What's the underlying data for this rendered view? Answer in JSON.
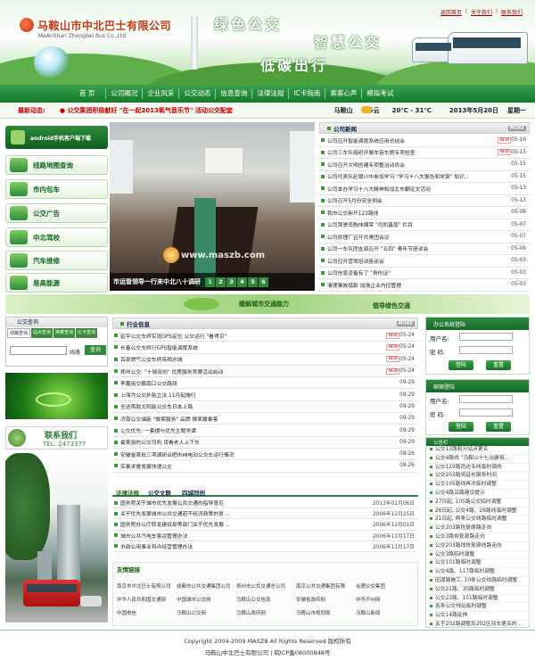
{
  "header": {
    "company_cn": "马鞍山市中北巴士有限公司",
    "company_en": "MaAnShan Zhongbei Bus Co.,Ltd",
    "slogan1": "绿色公交",
    "slogan2": "智慧公交",
    "slogan3": "低碳出行",
    "links": [
      "返回首页",
      "关于我们",
      "联系我们"
    ]
  },
  "nav": [
    "首 页",
    "公司概况",
    "企业风采",
    "公交动态",
    "信息查询",
    "法律法规",
    "IC卡指南",
    "乘客心声",
    "模拟考试"
  ],
  "newsbar": {
    "label": "最新动态:",
    "text": "● 公交集团积极献好 \"在一起2013氧气音乐节\" 活动公交配套",
    "city": "马鞍山",
    "weather": "多云",
    "temp": "20℃ - 31℃",
    "date": "2013年5月20日",
    "weekday": "星期一"
  },
  "android": "android手机客户端下载",
  "services": [
    "线路地图查询",
    "市内包车",
    "公交广告",
    "中北驾校",
    "汽车维修",
    "易高能源"
  ],
  "photo": {
    "caption": "市运管领导一行来中北八十调研",
    "pages": [
      "1",
      "2",
      "3",
      "4",
      "5",
      "6"
    ],
    "watermark": "www.maszb.com"
  },
  "company_news": {
    "title": "公司新闻",
    "more": "MORE",
    "tag": "NEW",
    "items": [
      {
        "t": "公司召开智能调度系统应用总结会",
        "d": "05-16",
        "new": true
      },
      {
        "t": "公司三车队组织开展车容车貌专项检查",
        "d": "05-15",
        "new": true
      },
      {
        "t": "公司召开文明创建专项整治动员会",
        "d": "05-15",
        "new": false
      },
      {
        "t": "公司代表队赴银川中参加学习 \"学习十八大报告和党章\" 知识...",
        "d": "05-15",
        "new": false
      },
      {
        "t": "公司本办学习十八大精神和加北市翻征文活动",
        "d": "05-13",
        "new": false
      },
      {
        "t": "公司召开5月份安全例会",
        "d": "05-13",
        "new": false
      },
      {
        "t": "我市公交新开123路线",
        "d": "05-08",
        "new": false
      },
      {
        "t": "公司驾驶员陶伟横荣 \"司机基层\" 栏目",
        "d": "05-07",
        "new": false
      },
      {
        "t": "公司修理厂召开共青团会议",
        "d": "05-07",
        "new": false
      },
      {
        "t": "公司一车队团支部召开 \"五四\" 青年节座谈会",
        "d": "05-06",
        "new": false
      },
      {
        "t": "公司召开营驾培训座谈会",
        "d": "05-03",
        "new": false
      },
      {
        "t": "公司信息设备有了 \"身份证\"",
        "d": "05-03",
        "new": false
      },
      {
        "t": "清理事故借款 加强企业内控管理",
        "d": "05-03",
        "new": false
      }
    ]
  },
  "band": {
    "left": "缓解城市交通能力",
    "right": "倡导绿色交通"
  },
  "query": {
    "title": "公交查询",
    "tabs": [
      "线路查询",
      "站点查询",
      "换乘查询",
      "IC卡查询"
    ],
    "label": "线路",
    "button": "查询"
  },
  "contact": {
    "title": "联系我们",
    "tel": "TEL: 2473377"
  },
  "industry": {
    "title": "行业信息",
    "more": "MORE",
    "items": [
      {
        "t": "延平公交车终实现GPS定位 公交运行 \"看得见\"",
        "d": "05-24",
        "new": true
      },
      {
        "t": "长春公交车终行GPS智能调度系统",
        "d": "05-24",
        "new": true
      },
      {
        "t": "百部燃气公交车终亮相水城",
        "d": "05-24",
        "new": true
      },
      {
        "t": "郑州公交: \"十城双创\" 优质服务竞赛活动启动",
        "d": "05-24",
        "new": true
      },
      {
        "t": "李嘉丽交鹏南口公交路段",
        "d": "09-29",
        "new": false
      },
      {
        "t": "上海为公交补贴立法 11月起施行",
        "d": "09-29",
        "new": false
      },
      {
        "t": "全途首款太阳能公交车日本上路",
        "d": "09-29",
        "new": false
      },
      {
        "t": "济南公交储能 \"微笑服务\" 品牌 微笑暖乘客",
        "d": "09-29",
        "new": false
      },
      {
        "t": "公交优先: 一套侵与优先主题学谭",
        "d": "09-29",
        "new": false
      },
      {
        "t": "最美丽的公交司机 货看老人上下车",
        "d": "09-29",
        "new": false
      },
      {
        "t": "安徽省首批三项调研合肥市纯电动公交车运行情况",
        "d": "08-26",
        "new": false
      },
      {
        "t": "实事求是发展快速公交",
        "d": "08-26",
        "new": false
      }
    ]
  },
  "law": {
    "tabs": [
      "法律法规",
      "公交文联",
      "四城同创"
    ],
    "items": [
      {
        "t": "国务院关于城市优先发展公共交通的指导意见",
        "d": "2013年01月06日"
      },
      {
        "t": "关于优先发展城市公共交通若干经济政策的意 ...",
        "d": "2006年12月25日"
      },
      {
        "t": "国务院办公厅转发建设部等部门关于优先发展 ...",
        "d": "2006年12月01日"
      },
      {
        "t": "城市公共汽电车客运管理办法",
        "d": "2006年11月17日"
      },
      {
        "t": "市政公用事业特许经营管理办法",
        "d": "2006年11月17日"
      }
    ]
  },
  "friend_links": {
    "title": "友情链接",
    "items": [
      [
        "南京市中北巴士有限公司",
        "成都市公共交通集团公司",
        "郑州市公共交通总公司",
        "南京公共交通集团有限",
        "合肥公交集团"
      ],
      [
        "中华人民共和国交通部",
        "中国城市公交网",
        "马鞍山公交信息",
        "安徽省政府网",
        "中华卢州网"
      ],
      [
        "中国电信",
        "马鞍山公交网",
        "马鞍山政府网",
        "马鞍山市规划局",
        "马鞍山新闻"
      ]
    ]
  },
  "login": {
    "title": "办公系统登陆",
    "user": "用户名:",
    "pass": "密 码:",
    "btn1": "登陆",
    "btn2": "重置"
  },
  "mail": {
    "title": "邮箱登陆",
    "user": "用户名:",
    "pass": "密 码:",
    "btn1": "登陆",
    "btn2": "重置"
  },
  "bulletin": {
    "title": "公告栏",
    "items": [
      "公交13路和分站点更名",
      "公交4路线 \"马鞍山十七冶建筑...",
      "公交129路司达专线临时调线",
      "公交203路将延长服务时间",
      "公交105路线再次临时调整",
      "公交4路沿路建设提示",
      "27日起, 105路公交临时调整",
      "26日起, 公交4路、26路线临时调整",
      "21日起, 两条公交线路临时调整",
      "公交203路恢复原路走向",
      "公交3路恢复原路走向",
      "公交203路线恢复原线路走向",
      "公交3路临时调整",
      "公交101路临时调整",
      "公交4路、117路临时调整",
      "因道路施工, 10条公交线路临时调整",
      "公交21路、30路临时调整",
      "公交23路、101路临时调整",
      "各条公交线站临时调整",
      "公交14路延伸",
      "关于202路调整及202区间车更名的..."
    ]
  },
  "footer": {
    "line1": "Copyright 2004-2009 MASZB All Rights Reserved 版权所有",
    "line2": "马鞍山中北巴士有限公司 | 皖ICP备08000848号"
  }
}
